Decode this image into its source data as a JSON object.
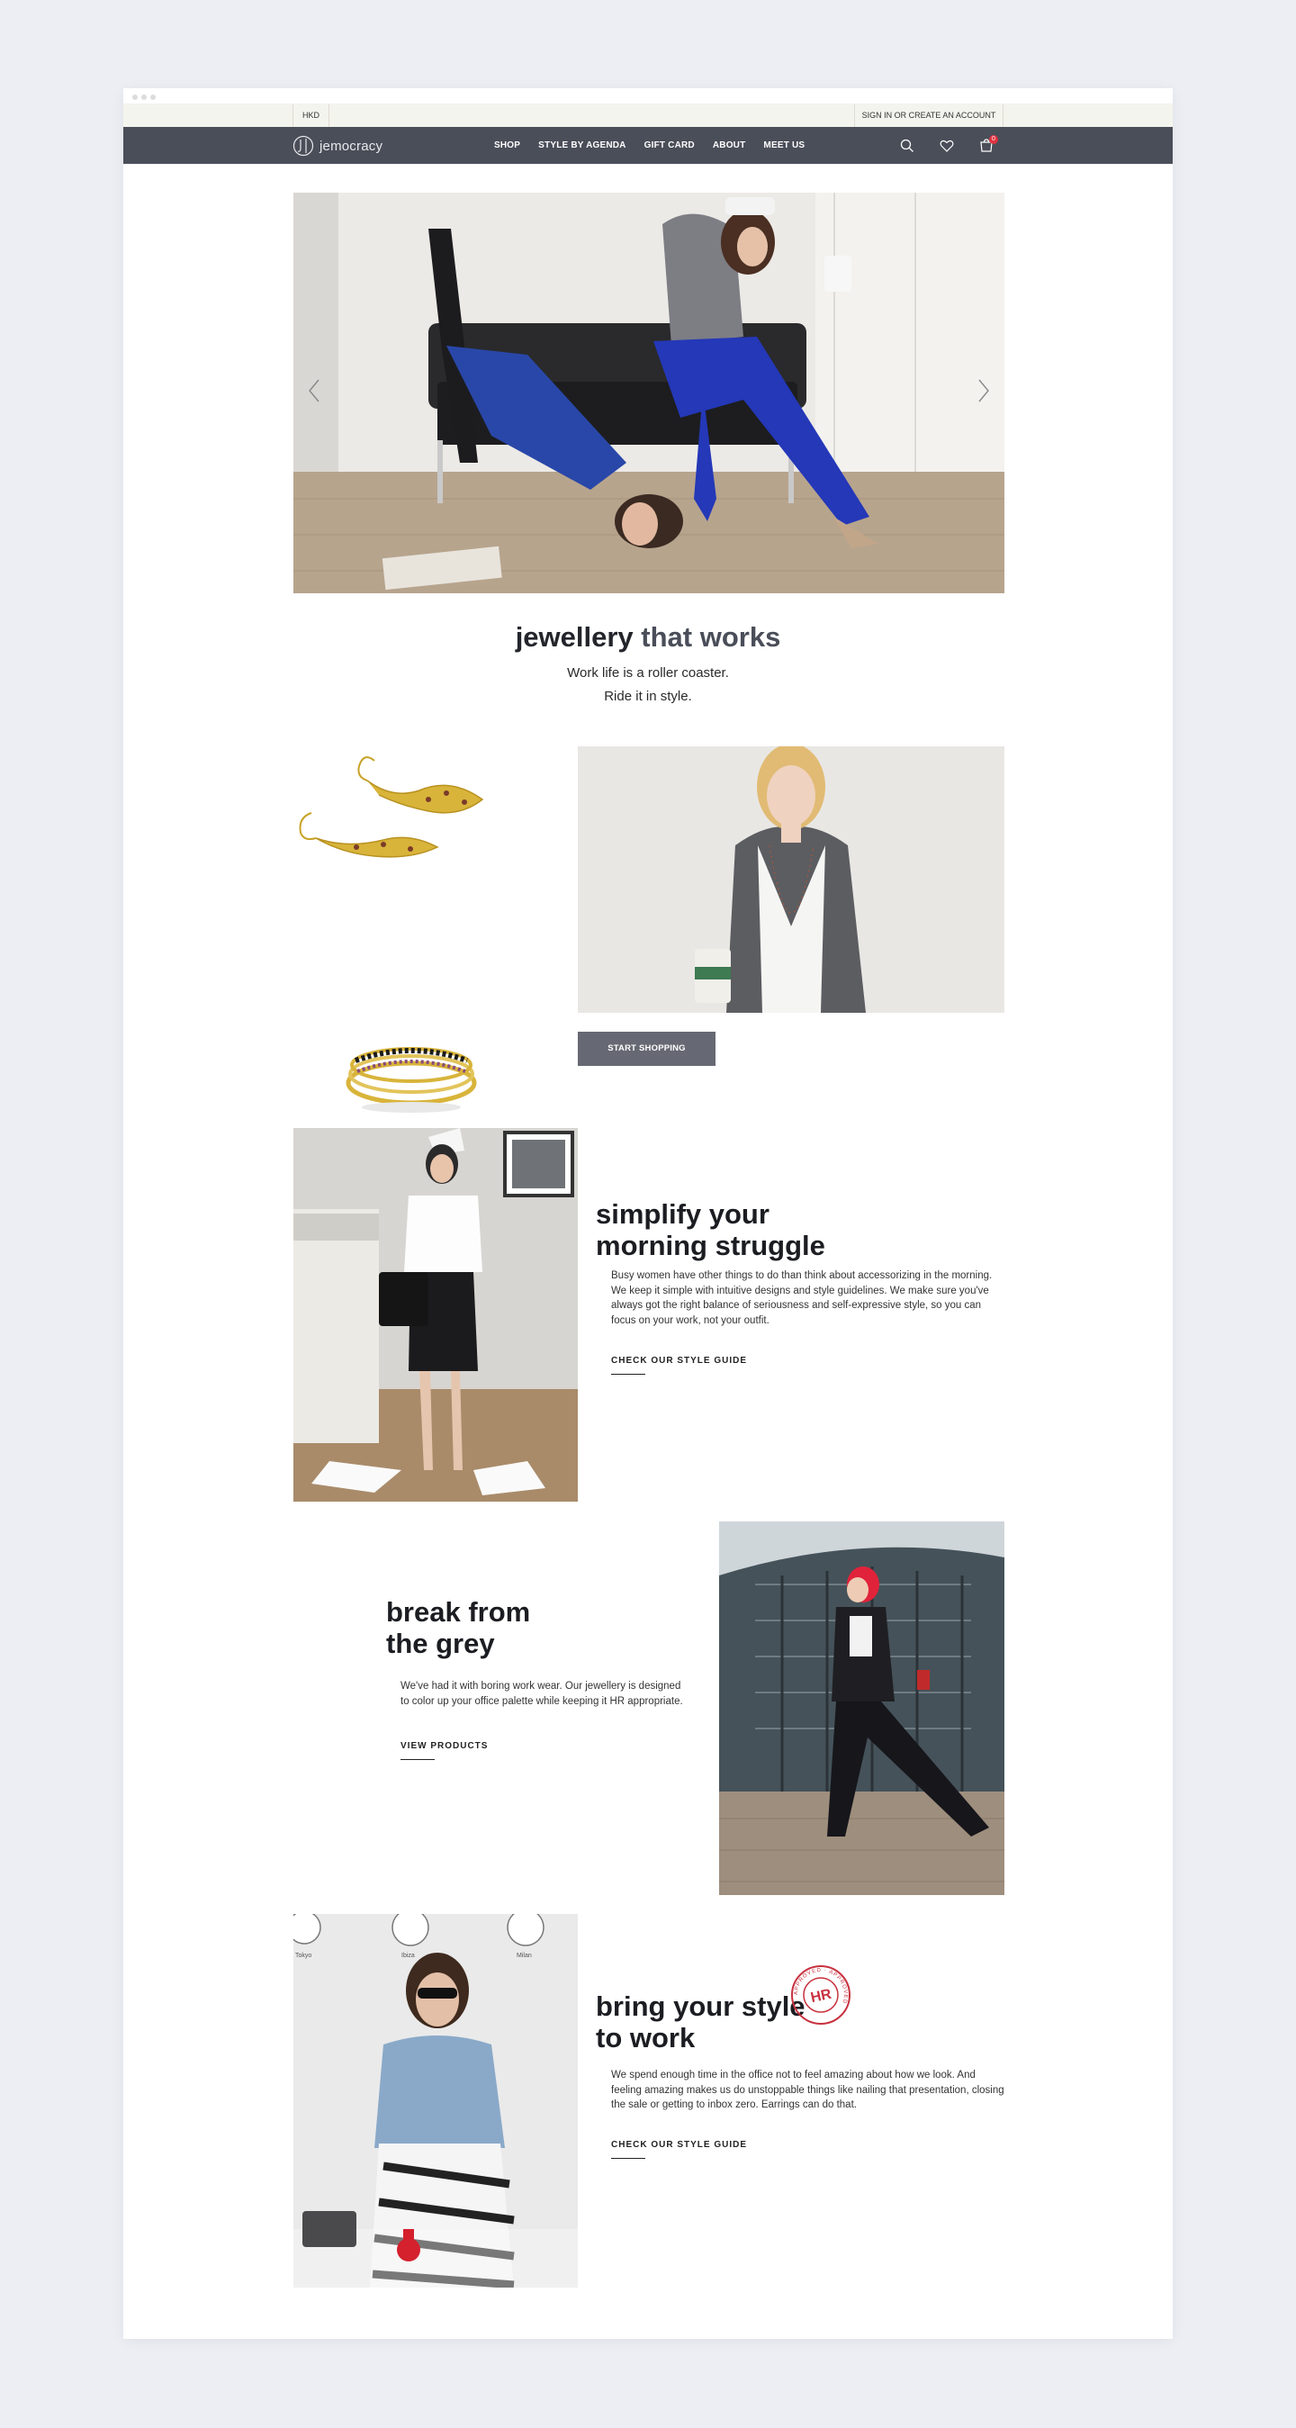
{
  "topbar": {
    "currency": "HKD",
    "account": "SIGN IN OR CREATE AN ACCOUNT"
  },
  "navbar": {
    "logo_text": "jemocracy",
    "links": [
      "SHOP",
      "STYLE BY AGENDA",
      "GIFT CARD",
      "ABOUT",
      "MEET US"
    ],
    "cart_count": "0"
  },
  "hero": {
    "title_part1": "jewellery ",
    "title_part2": "that works",
    "subtitle_line1": "Work life is a roller coaster.",
    "subtitle_line2": "Ride it in style."
  },
  "featured": {
    "cta": "START SHOPPING"
  },
  "sections": [
    {
      "title_line1": "simplify your",
      "title_line2": "morning struggle",
      "body": "Busy women have other things to do than think about accessorizing in the morning. We keep it simple with intuitive designs and style guidelines. We make sure you've always got the right balance of seriousness and self-expressive style, so you can focus on your work, not your outfit.",
      "link": "CHECK OUR STYLE GUIDE"
    },
    {
      "title_line1": "break from",
      "title_line2": "the grey",
      "body": "We've had it with boring work wear. Our jewellery is designed to color up your office palette while keeping it HR appropriate.",
      "link": "VIEW PRODUCTS"
    },
    {
      "title_line1": "bring your style",
      "title_line2": "to work",
      "body": "We spend enough time in the office not to feel amazing about how we look. And feeling amazing makes us do unstoppable things like nailing that presentation, closing the sale or getting to inbox zero. Earrings can do that.",
      "link": "CHECK OUR STYLE GUIDE"
    }
  ],
  "clock_labels": [
    "Tokyo",
    "Ibiza",
    "Milan"
  ],
  "stamp": {
    "text": "HR",
    "ring": "APPROVED · APPROVED"
  },
  "colors": {
    "nav": "#4a4e59",
    "topbar": "#f4f4ee",
    "button": "#666973",
    "badge": "#e03340",
    "stamp": "#c8313f"
  }
}
